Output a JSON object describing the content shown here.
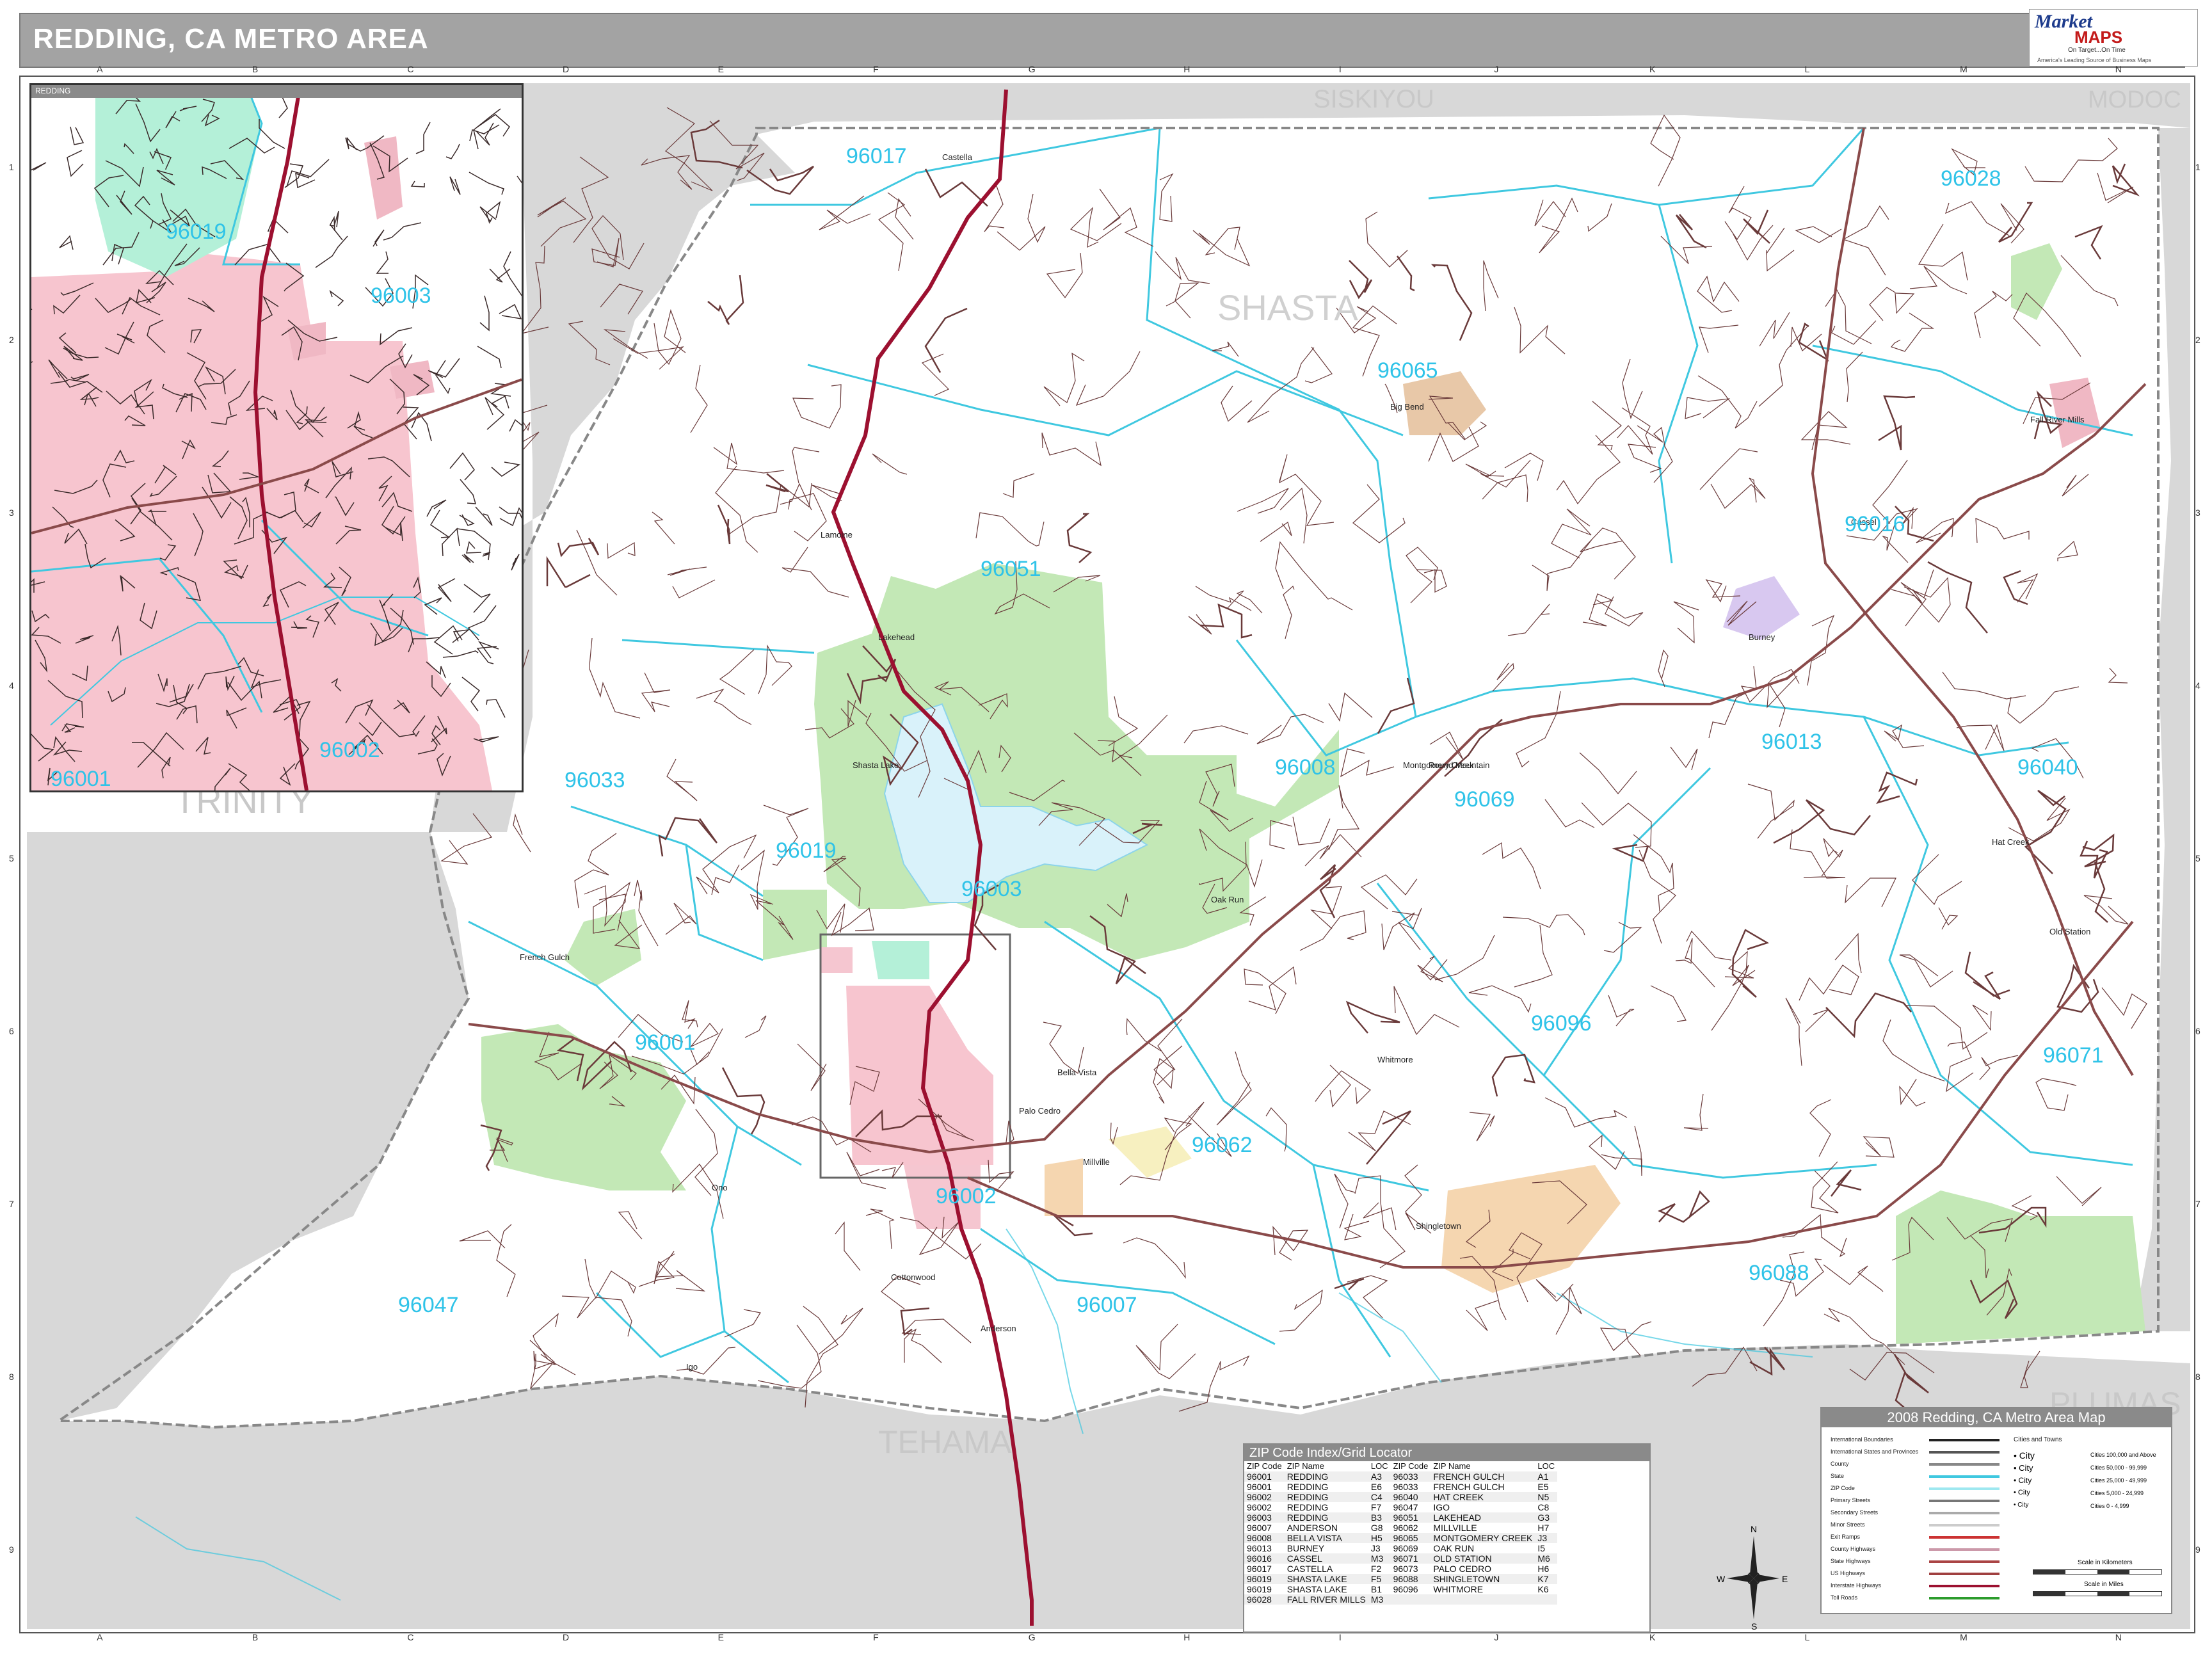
{
  "map_title": "REDDING, CA METRO AREA",
  "logo": {
    "brand_line1": "Market",
    "brand_line2": "MAPS",
    "tagline": "On Target...On Time",
    "subtitle": "America's Leading Source of Business Maps"
  },
  "inset_title": "REDDING",
  "grid_columns": [
    "A",
    "B",
    "C",
    "D",
    "E",
    "F",
    "G",
    "H",
    "I",
    "J",
    "K",
    "L",
    "M",
    "N"
  ],
  "grid_rows": [
    "1",
    "2",
    "3",
    "4",
    "5",
    "6",
    "7",
    "8",
    "9"
  ],
  "county_labels": [
    "SISKIYOU",
    "MODOC",
    "SHASTA",
    "TRINITY",
    "PLUMAS",
    "TEHAMA"
  ],
  "zip_labels": [
    "96017",
    "96028",
    "96065",
    "96016",
    "96051",
    "96013",
    "96008",
    "96040",
    "96033",
    "96069",
    "96019",
    "96003",
    "96001",
    "96096",
    "96071",
    "96062",
    "96002",
    "96088",
    "96047",
    "96007"
  ],
  "inset_zip_labels": [
    "96019",
    "96003",
    "96002",
    "96001"
  ],
  "places": [
    "Castella",
    "Lamoine",
    "Lakehead",
    "Shasta Lake",
    "Bella Vista",
    "Palo Cedro",
    "Millville",
    "Shingletown",
    "Anderson",
    "Cottonwood",
    "Burney",
    "Fall River Mills",
    "Montgomery Creek",
    "Round Mountain",
    "Oak Run",
    "Whitmore",
    "French Gulch",
    "Igo",
    "Ono",
    "Old Station",
    "Cassel",
    "Hat Creek",
    "Big Bend"
  ],
  "legend": {
    "title": "2008 Redding, CA Metro Area Map",
    "rows": [
      "International Boundaries",
      "International States and Provinces",
      "County",
      "State",
      "ZIP Code",
      "Primary Streets",
      "Secondary Streets",
      "Minor Streets",
      "Exit Ramps",
      "County Highways",
      "State Highways",
      "US Highways",
      "Interstate Highways",
      "Toll Roads"
    ],
    "cities_header": "Cities and Towns",
    "cities": [
      {
        "name": "City",
        "pop": "Cities 100,000 and Above"
      },
      {
        "name": "City",
        "pop": "Cities 50,000 - 99,999"
      },
      {
        "name": "City",
        "pop": "Cities 25,000 - 49,999"
      },
      {
        "name": "City",
        "pop": "Cities 5,000 - 24,999"
      },
      {
        "name": "City",
        "pop": "Cities 0 - 4,999"
      }
    ],
    "scale_km": "Scale in Kilometers",
    "scale_mi": "Scale in Miles"
  },
  "zip_index": {
    "title": "ZIP Code Index/Grid Locator",
    "headers": [
      "ZIP Code",
      "ZIP Name",
      "LOC",
      "ZIP Code",
      "ZIP Name",
      "LOC"
    ],
    "rows": [
      [
        "96001",
        "REDDING",
        "A3",
        "96033",
        "FRENCH GULCH",
        "A1"
      ],
      [
        "96001",
        "REDDING",
        "E6",
        "96033",
        "FRENCH GULCH",
        "E5"
      ],
      [
        "96002",
        "REDDING",
        "C4",
        "96040",
        "HAT CREEK",
        "N5"
      ],
      [
        "96002",
        "REDDING",
        "F7",
        "96047",
        "IGO",
        "C8"
      ],
      [
        "96003",
        "REDDING",
        "B3",
        "96051",
        "LAKEHEAD",
        "G3"
      ],
      [
        "96007",
        "ANDERSON",
        "G8",
        "96062",
        "MILLVILLE",
        "H7"
      ],
      [
        "96008",
        "BELLA VISTA",
        "H5",
        "96065",
        "MONTGOMERY CREEK",
        "J3"
      ],
      [
        "96013",
        "BURNEY",
        "J3",
        "96069",
        "OAK RUN",
        "I5"
      ],
      [
        "96016",
        "CASSEL",
        "M3",
        "96071",
        "OLD STATION",
        "M6"
      ],
      [
        "96017",
        "CASTELLA",
        "F2",
        "96073",
        "PALO CEDRO",
        "H6"
      ],
      [
        "96019",
        "SHASTA LAKE",
        "F5",
        "96088",
        "SHINGLETOWN",
        "K7"
      ],
      [
        "96019",
        "SHASTA LAKE",
        "B1",
        "96096",
        "WHITMORE",
        "K6"
      ],
      [
        "96028",
        "FALL RIVER MILLS",
        "M3",
        "",
        "",
        ""
      ]
    ]
  },
  "compass": {
    "n": "N",
    "s": "S",
    "e": "E",
    "w": "W"
  },
  "colors": {
    "zip_line": "#3fc8e0",
    "zip_label": "#2fc3e8",
    "green_area": "#bde8b0",
    "pink_area": "#f7c5cf",
    "mint_area": "#b4f0d8",
    "gray_outside": "#d7d7d7",
    "highway": "#a01030",
    "lake": "#d4f0f8"
  }
}
